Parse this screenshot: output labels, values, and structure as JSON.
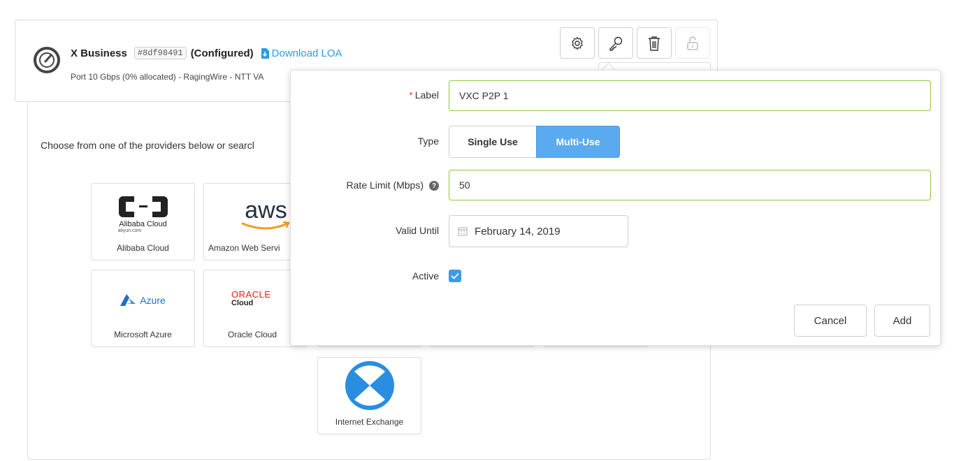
{
  "port": {
    "name": "X Business",
    "uid": "#8df98491",
    "status": "(Configured)",
    "loa_link": "Download LOA",
    "details": "Port 10 Gbps (0% allocated) - RagingWire - NTT VA"
  },
  "toolbar": {
    "icons": [
      "gear-icon",
      "key-icon",
      "trash-icon",
      "lock-icon"
    ]
  },
  "providers": {
    "prompt": "Choose from one of the providers below or searcl",
    "tiles": [
      {
        "label": "Alibaba Cloud",
        "logo_text": "Alibaba Cloud",
        "logo_subtext": "aliyun.com"
      },
      {
        "label": "Amazon Web Servi",
        "logo_text": "aws"
      },
      {
        "label": "Microsoft Azure",
        "logo_text": "Azure"
      },
      {
        "label": "Oracle Cloud",
        "logo_text": "ORACLE",
        "logo_subtext": "Cloud"
      },
      {
        "label": "Internet Exchange"
      }
    ]
  },
  "form": {
    "label_field": {
      "label": "Label",
      "required_mark": "*",
      "value": "VXC P2P 1"
    },
    "type_field": {
      "label": "Type",
      "options": [
        "Single Use",
        "Multi-Use"
      ],
      "selected": "Multi-Use"
    },
    "rate_limit": {
      "label": "Rate Limit (Mbps)",
      "help": "?",
      "value": "50"
    },
    "valid_until": {
      "label": "Valid Until",
      "value": "February 14, 2019"
    },
    "active": {
      "label": "Active",
      "checked": true
    },
    "cancel_label": "Cancel",
    "add_label": "Add"
  },
  "colors": {
    "accent": "#2f9ae5",
    "selected_segment": "#5aaaf0",
    "valid_border": "#8cc63f",
    "required": "#e04040"
  }
}
